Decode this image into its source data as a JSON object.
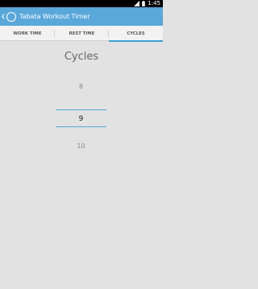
{
  "status_bar": {
    "time": "1:45",
    "icons": [
      "signal-icon",
      "battery-icon"
    ]
  },
  "app": {
    "title": "Tabata Workout Timer",
    "back_icon": "chevron-left-icon",
    "logo_icon": "app-logo-icon"
  },
  "tabs": [
    {
      "label": "WORK TIME",
      "selected": false
    },
    {
      "label": "REST TIME",
      "selected": false
    },
    {
      "label": "CYCLES",
      "selected": true
    }
  ],
  "cycles": {
    "heading": "Cycles",
    "previous": "8",
    "current": "9",
    "next": "10"
  },
  "colors": {
    "action_bar": "#5aa7da",
    "accent": "#3f9fd6",
    "background": "#e2e2e2"
  }
}
